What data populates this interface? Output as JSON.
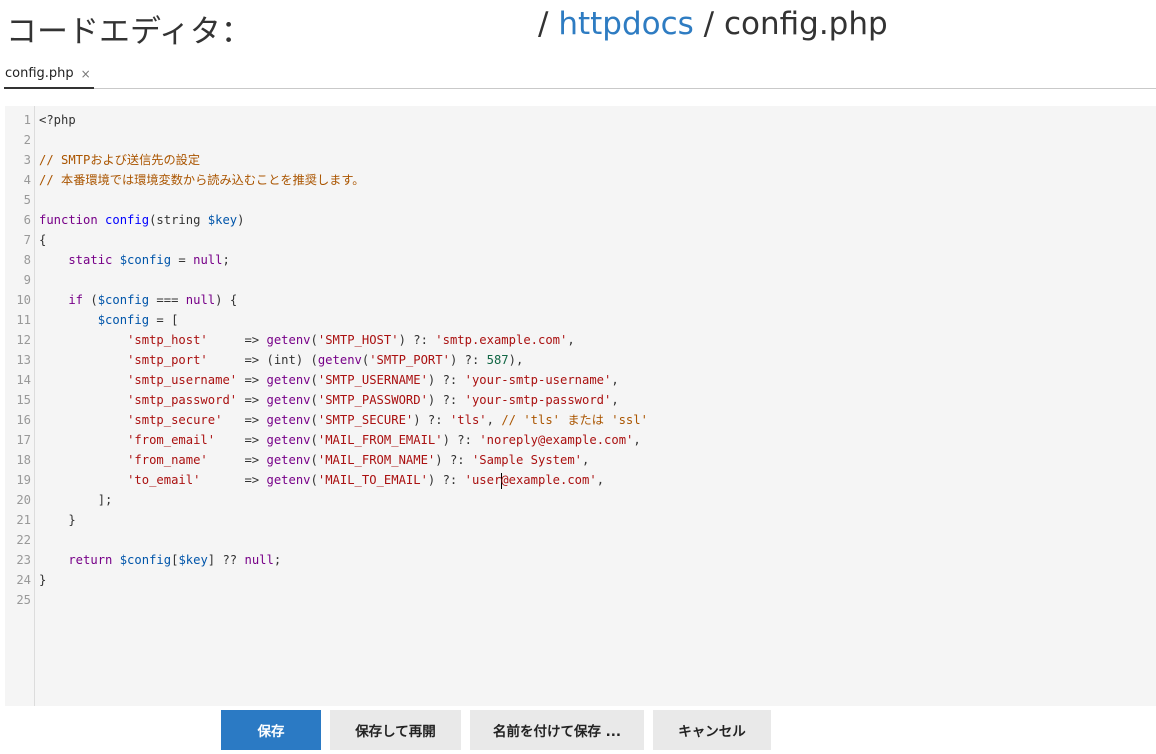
{
  "header": {
    "title": "コードエディタ：",
    "breadcrumb": [
      {
        "label": "httpdocs",
        "link": true
      },
      {
        "label": "config.php",
        "link": false
      }
    ],
    "separator": "/"
  },
  "tabs": [
    {
      "label": "config.php",
      "close": "×"
    }
  ],
  "editor": {
    "lines": [
      {
        "n": "1",
        "tokens": [
          {
            "t": "<?php",
            "c": "pl"
          }
        ]
      },
      {
        "n": "2",
        "tokens": []
      },
      {
        "n": "3",
        "tokens": [
          {
            "t": "// SMTPおよび送信先の設定",
            "c": "cm"
          }
        ]
      },
      {
        "n": "4",
        "tokens": [
          {
            "t": "// 本番環境では環境変数から読み込むことを推奨します。",
            "c": "cm"
          }
        ]
      },
      {
        "n": "5",
        "tokens": []
      },
      {
        "n": "6",
        "tokens": [
          {
            "t": "function ",
            "c": "kw"
          },
          {
            "t": "config",
            "c": "fn"
          },
          {
            "t": "(string ",
            "c": "pl"
          },
          {
            "t": "$key",
            "c": "vr"
          },
          {
            "t": ")",
            "c": "pl"
          }
        ]
      },
      {
        "n": "7",
        "tokens": [
          {
            "t": "{",
            "c": "pl"
          }
        ]
      },
      {
        "n": "8",
        "tokens": [
          {
            "t": "    static ",
            "c": "kw"
          },
          {
            "t": "$config",
            "c": "vr"
          },
          {
            "t": " = ",
            "c": "pl"
          },
          {
            "t": "null",
            "c": "kw"
          },
          {
            "t": ";",
            "c": "pl"
          }
        ]
      },
      {
        "n": "9",
        "tokens": []
      },
      {
        "n": "10",
        "tokens": [
          {
            "t": "    if ",
            "c": "kw"
          },
          {
            "t": "(",
            "c": "pl"
          },
          {
            "t": "$config",
            "c": "vr"
          },
          {
            "t": " === ",
            "c": "pl"
          },
          {
            "t": "null",
            "c": "kw"
          },
          {
            "t": ") {",
            "c": "pl"
          }
        ]
      },
      {
        "n": "11",
        "tokens": [
          {
            "t": "        ",
            "c": "pl"
          },
          {
            "t": "$config",
            "c": "vr"
          },
          {
            "t": " = [",
            "c": "pl"
          }
        ]
      },
      {
        "n": "12",
        "tokens": [
          {
            "t": "            ",
            "c": "pl"
          },
          {
            "t": "'smtp_host'",
            "c": "st"
          },
          {
            "t": "     => ",
            "c": "pl"
          },
          {
            "t": "getenv",
            "c": "kw"
          },
          {
            "t": "(",
            "c": "pl"
          },
          {
            "t": "'SMTP_HOST'",
            "c": "st"
          },
          {
            "t": ") ?: ",
            "c": "pl"
          },
          {
            "t": "'smtp.example.com'",
            "c": "st"
          },
          {
            "t": ",",
            "c": "pl"
          }
        ]
      },
      {
        "n": "13",
        "tokens": [
          {
            "t": "            ",
            "c": "pl"
          },
          {
            "t": "'smtp_port'",
            "c": "st"
          },
          {
            "t": "     => (int) (",
            "c": "pl"
          },
          {
            "t": "getenv",
            "c": "kw"
          },
          {
            "t": "(",
            "c": "pl"
          },
          {
            "t": "'SMTP_PORT'",
            "c": "st"
          },
          {
            "t": ") ?: ",
            "c": "pl"
          },
          {
            "t": "587",
            "c": "nm"
          },
          {
            "t": "),",
            "c": "pl"
          }
        ]
      },
      {
        "n": "14",
        "tokens": [
          {
            "t": "            ",
            "c": "pl"
          },
          {
            "t": "'smtp_username'",
            "c": "st"
          },
          {
            "t": " => ",
            "c": "pl"
          },
          {
            "t": "getenv",
            "c": "kw"
          },
          {
            "t": "(",
            "c": "pl"
          },
          {
            "t": "'SMTP_USERNAME'",
            "c": "st"
          },
          {
            "t": ") ?: ",
            "c": "pl"
          },
          {
            "t": "'your-smtp-username'",
            "c": "st"
          },
          {
            "t": ",",
            "c": "pl"
          }
        ]
      },
      {
        "n": "15",
        "tokens": [
          {
            "t": "            ",
            "c": "pl"
          },
          {
            "t": "'smtp_password'",
            "c": "st"
          },
          {
            "t": " => ",
            "c": "pl"
          },
          {
            "t": "getenv",
            "c": "kw"
          },
          {
            "t": "(",
            "c": "pl"
          },
          {
            "t": "'SMTP_PASSWORD'",
            "c": "st"
          },
          {
            "t": ") ?: ",
            "c": "pl"
          },
          {
            "t": "'your-smtp-password'",
            "c": "st"
          },
          {
            "t": ",",
            "c": "pl"
          }
        ]
      },
      {
        "n": "16",
        "tokens": [
          {
            "t": "            ",
            "c": "pl"
          },
          {
            "t": "'smtp_secure'",
            "c": "st"
          },
          {
            "t": "   => ",
            "c": "pl"
          },
          {
            "t": "getenv",
            "c": "kw"
          },
          {
            "t": "(",
            "c": "pl"
          },
          {
            "t": "'SMTP_SECURE'",
            "c": "st"
          },
          {
            "t": ") ?: ",
            "c": "pl"
          },
          {
            "t": "'tls'",
            "c": "st"
          },
          {
            "t": ", ",
            "c": "pl"
          },
          {
            "t": "// 'tls' または 'ssl'",
            "c": "cm"
          }
        ]
      },
      {
        "n": "17",
        "tokens": [
          {
            "t": "            ",
            "c": "pl"
          },
          {
            "t": "'from_email'",
            "c": "st"
          },
          {
            "t": "    => ",
            "c": "pl"
          },
          {
            "t": "getenv",
            "c": "kw"
          },
          {
            "t": "(",
            "c": "pl"
          },
          {
            "t": "'MAIL_FROM_EMAIL'",
            "c": "st"
          },
          {
            "t": ") ?: ",
            "c": "pl"
          },
          {
            "t": "'noreply@example.com'",
            "c": "st"
          },
          {
            "t": ",",
            "c": "pl"
          }
        ]
      },
      {
        "n": "18",
        "tokens": [
          {
            "t": "            ",
            "c": "pl"
          },
          {
            "t": "'from_name'",
            "c": "st"
          },
          {
            "t": "     => ",
            "c": "pl"
          },
          {
            "t": "getenv",
            "c": "kw"
          },
          {
            "t": "(",
            "c": "pl"
          },
          {
            "t": "'MAIL_FROM_NAME'",
            "c": "st"
          },
          {
            "t": ") ?: ",
            "c": "pl"
          },
          {
            "t": "'Sample System'",
            "c": "st"
          },
          {
            "t": ",",
            "c": "pl"
          }
        ]
      },
      {
        "n": "19",
        "tokens": [
          {
            "t": "            ",
            "c": "pl"
          },
          {
            "t": "'to_email'",
            "c": "st"
          },
          {
            "t": "      => ",
            "c": "pl"
          },
          {
            "t": "getenv",
            "c": "kw"
          },
          {
            "t": "(",
            "c": "pl"
          },
          {
            "t": "'MAIL_TO_EMAIL'",
            "c": "st"
          },
          {
            "t": ") ?: ",
            "c": "pl"
          },
          {
            "t": "'user",
            "c": "st"
          },
          {
            "cursor": true
          },
          {
            "t": "@example.com'",
            "c": "st"
          },
          {
            "t": ",",
            "c": "pl"
          }
        ]
      },
      {
        "n": "20",
        "tokens": [
          {
            "t": "        ];",
            "c": "pl"
          }
        ]
      },
      {
        "n": "21",
        "tokens": [
          {
            "t": "    }",
            "c": "pl"
          }
        ]
      },
      {
        "n": "22",
        "tokens": []
      },
      {
        "n": "23",
        "tokens": [
          {
            "t": "    return ",
            "c": "kw"
          },
          {
            "t": "$config",
            "c": "vr"
          },
          {
            "t": "[",
            "c": "pl"
          },
          {
            "t": "$key",
            "c": "vr"
          },
          {
            "t": "] ?? ",
            "c": "pl"
          },
          {
            "t": "null",
            "c": "kw"
          },
          {
            "t": ";",
            "c": "pl"
          }
        ]
      },
      {
        "n": "24",
        "tokens": [
          {
            "t": "}",
            "c": "pl"
          }
        ]
      },
      {
        "n": "25",
        "tokens": []
      }
    ]
  },
  "buttons": {
    "save": "保存",
    "save_reopen": "保存して再開",
    "save_as": "名前を付けて保存 ...",
    "cancel": "キャンセル"
  },
  "colors": {
    "accent": "#2b7ac4",
    "link": "#2e7cc2",
    "keyword": "#770088",
    "function": "#0000ff",
    "variable": "#0055aa",
    "string": "#aa1111",
    "comment": "#aa5500",
    "number": "#116644"
  }
}
